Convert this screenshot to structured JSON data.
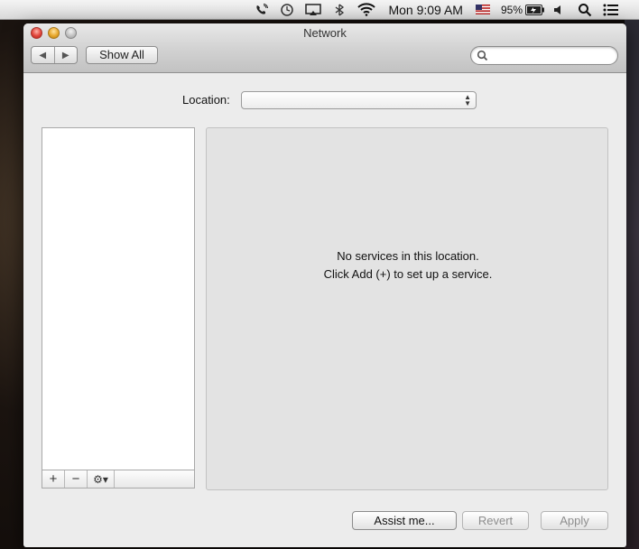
{
  "menubar": {
    "clock": "Mon 9:09 AM",
    "battery_percent": "95%",
    "icons": [
      "phone-icon",
      "time-machine-icon",
      "airplay-icon",
      "bluetooth-icon",
      "wifi-icon",
      "us-flag-icon",
      "battery-icon",
      "volume-icon",
      "spotlight-icon",
      "notification-center-icon"
    ]
  },
  "window": {
    "title": "Network",
    "toolbar": {
      "back_label": "◀",
      "forward_label": "▶",
      "show_all_label": "Show All",
      "search_placeholder": ""
    },
    "location": {
      "label": "Location:",
      "selected_value": ""
    },
    "services_toolbar": {
      "add_label": "+",
      "remove_label": "−",
      "gear_label": "⚙▾"
    },
    "detail": {
      "line1": "No services in this location.",
      "line2": "Click Add (+) to set up a service."
    },
    "buttons": {
      "assist": "Assist me...",
      "revert": "Revert",
      "apply": "Apply"
    }
  },
  "colors": {
    "close": "#e0443a",
    "minimize": "#e7a72b",
    "zoom": "#bdbdbd",
    "disabled_text": "#8d8d8d"
  }
}
